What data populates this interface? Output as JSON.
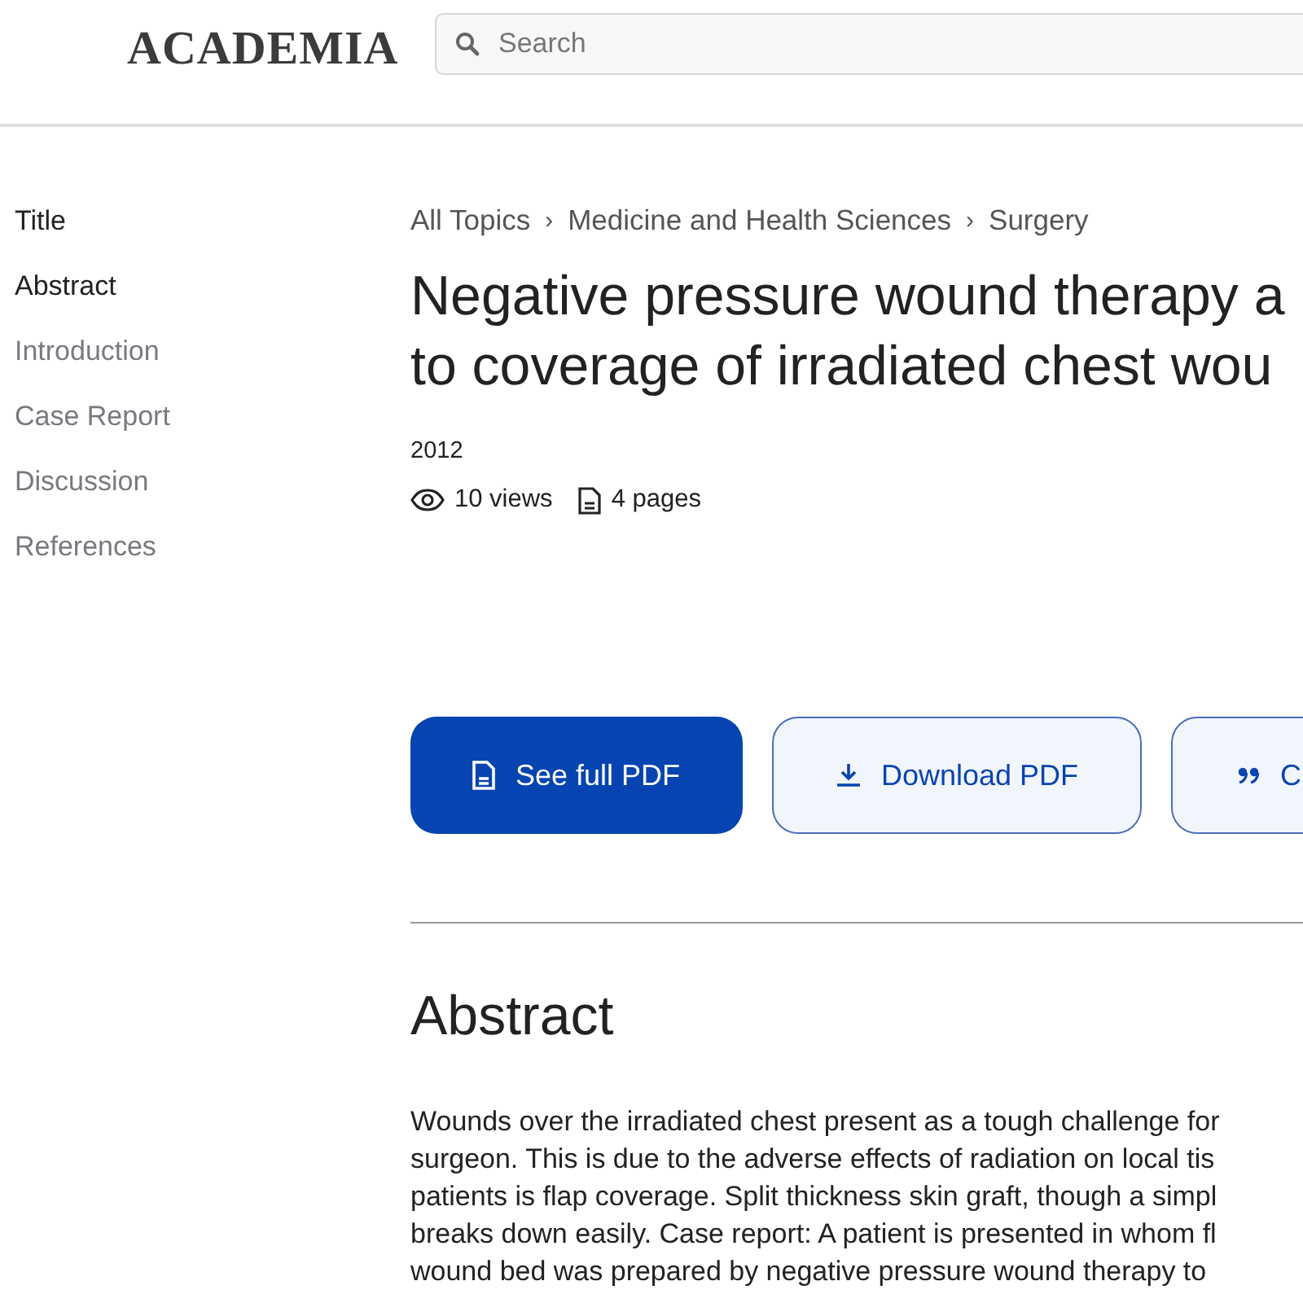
{
  "header": {
    "logo": "ACADEMIA",
    "search": {
      "placeholder": "Search"
    }
  },
  "outline": [
    {
      "label": "Title",
      "active": true
    },
    {
      "label": "Abstract",
      "active": true
    },
    {
      "label": "Introduction",
      "active": false
    },
    {
      "label": "Case Report",
      "active": false
    },
    {
      "label": "Discussion",
      "active": false
    },
    {
      "label": "References",
      "active": false
    }
  ],
  "breadcrumb": [
    "All Topics",
    "Medicine and Health Sciences",
    "Surgery"
  ],
  "breadcrumb_separator": "›",
  "title_lines": [
    "Negative pressure wound therapy a",
    "to coverage of irradiated chest wou"
  ],
  "year": "2012",
  "views": "10 views",
  "pages": "4 pages",
  "buttons": [
    {
      "kind": "primary",
      "label": "See full PDF"
    },
    {
      "kind": "download",
      "label": "Download PDF"
    },
    {
      "kind": "cite",
      "label": "C"
    }
  ],
  "abstract": {
    "heading": "Abstract",
    "lines": [
      "Wounds over the irradiated chest present as a tough challenge for",
      "surgeon. This is due to the adverse effects of radiation on local tis",
      "patients is flap coverage. Split thickness skin graft, though a simpl",
      "breaks down easily. Case report: A patient is presented in whom fl",
      "wound bed was prepared by negative pressure wound therapy to"
    ]
  }
}
